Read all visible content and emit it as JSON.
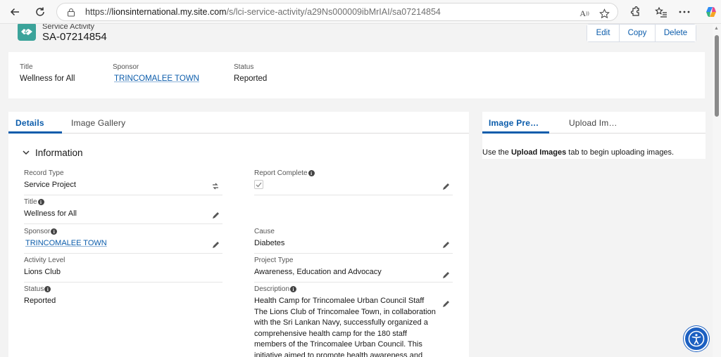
{
  "browser": {
    "url_prefix": "https://",
    "url_host": "lionsinternational.my.site.com",
    "url_path": "/s/lci-service-activity/a29Ns000009ibMrIAI/sa07214854",
    "read_aloud_label": "A",
    "read_aloud_sup": "))"
  },
  "header": {
    "object_type": "Service Activity",
    "record_name": "SA-07214854",
    "actions": [
      "Edit",
      "Copy",
      "Delete"
    ]
  },
  "highlights": {
    "title_label": "Title",
    "title_value": "Wellness for All",
    "sponsor_label": "Sponsor",
    "sponsor_value": "TRINCOMALEE TOWN",
    "status_label": "Status",
    "status_value": "Reported"
  },
  "details": {
    "tabs": [
      "Details",
      "Image Gallery"
    ],
    "section_title": "Information",
    "fields": {
      "record_type_label": "Record Type",
      "record_type_value": "Service Project",
      "report_complete_label": "Report Complete",
      "report_complete_checked": true,
      "title_label": "Title",
      "title_value": "Wellness for All",
      "sponsor_label": "Sponsor",
      "sponsor_value": "TRINCOMALEE TOWN",
      "cause_label": "Cause",
      "cause_value": "Diabetes",
      "activity_level_label": "Activity Level",
      "activity_level_value": "Lions Club",
      "project_type_label": "Project Type",
      "project_type_value": "Awareness, Education and Advocacy",
      "status_label": "Status",
      "status_value": "Reported",
      "description_label": "Description",
      "description_lines": [
        "Health Camp for Trincomalee Urban Council Staff",
        "The Lions Club of Trincomalee Town, in collaboration",
        "with the Sri Lankan Navy, successfully organized a",
        "comprehensive health camp for the 180 staff",
        "members of the Trincomalee Urban Council. This",
        "initiative aimed to promote health awareness and"
      ]
    }
  },
  "image_panel": {
    "tabs": [
      "Image Pre…",
      "Upload Im…"
    ],
    "message_before": "Use the ",
    "message_bold": "Upload Images",
    "message_after": " tab to begin uploading images."
  },
  "colors": {
    "brand_teal": "#3ba39a",
    "link_blue": "#0b5cab",
    "accessibility_blue": "#1b5fc1"
  }
}
